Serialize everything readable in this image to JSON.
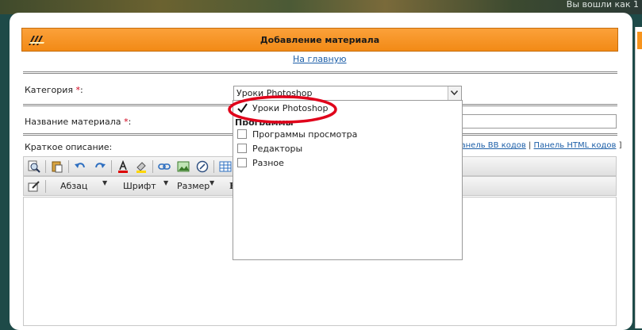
{
  "site": {
    "status_text": "Вы вошли как 1"
  },
  "header": {
    "title": "Добавление материала"
  },
  "nav": {
    "home_link": "На главную"
  },
  "form": {
    "category_label": "Категория",
    "required_mark": "*",
    "category_selected": "Уроки Photoshop",
    "title_label": "Название материала",
    "short_desc_label": "Краткое описание:",
    "panel_bb": "Панель BB кодов",
    "panel_html": "Панель HTML кодов",
    "colon": ":"
  },
  "dropdown": {
    "items": [
      {
        "label": "Уроки Photoshop",
        "checked": true
      },
      {
        "label": "Программы просмотра",
        "checked": false
      },
      {
        "label": "Редакторы",
        "checked": false
      },
      {
        "label": "Разное",
        "checked": false
      }
    ],
    "group_label": "Программы"
  },
  "toolbar": {
    "paragraph_label": "Абзац",
    "font_label": "Шрифт",
    "size_label": "Размер"
  },
  "colors": {
    "header_bg": "#f7941d",
    "link": "#1d5fa8",
    "required": "#d0001a",
    "annotation": "#e0001a",
    "page_bg": "#1e4a48"
  }
}
